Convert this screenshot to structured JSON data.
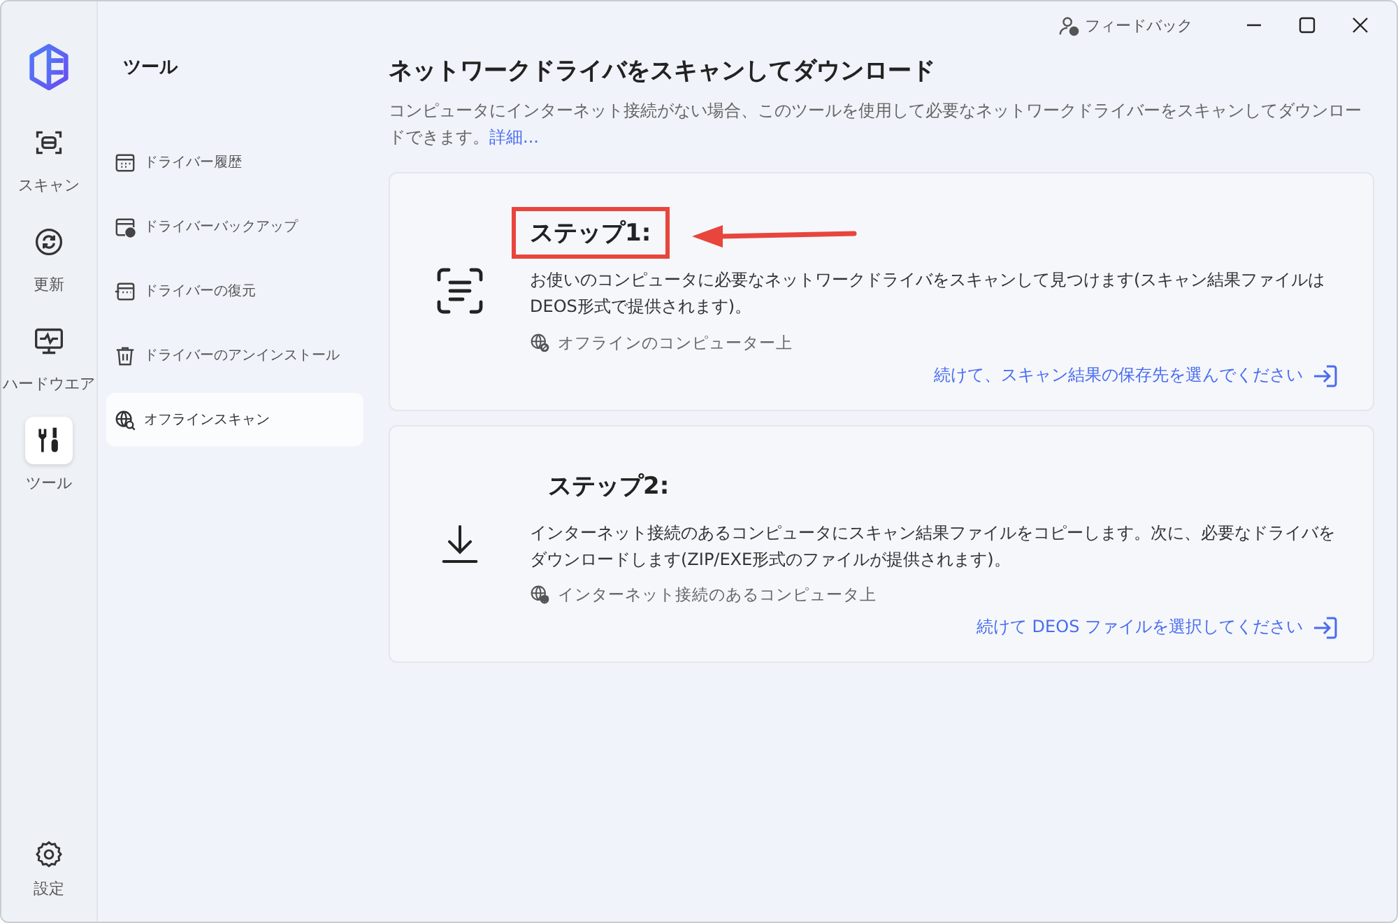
{
  "titlebar": {
    "feedback": "フィードバック"
  },
  "rail": {
    "items": [
      {
        "label": "スキャン",
        "selected": false
      },
      {
        "label": "更新",
        "selected": false
      },
      {
        "label": "ハードウエア",
        "selected": false
      },
      {
        "label": "ツール",
        "selected": true
      }
    ],
    "bottom": {
      "label": "設定"
    }
  },
  "tools_menu": {
    "title": "ツール",
    "items": [
      {
        "label": "ドライバー履歴",
        "selected": false
      },
      {
        "label": "ドライバーバックアップ",
        "selected": false
      },
      {
        "label": "ドライバーの復元",
        "selected": false
      },
      {
        "label": "ドライバーのアンインストール",
        "selected": false
      },
      {
        "label": "オフラインスキャン",
        "selected": true
      }
    ]
  },
  "main": {
    "title": "ネットワークドライバをスキャンしてダウンロード",
    "description": "コンピュータにインターネット接続がない場合、このツールを使用して必要なネットワークドライバーをスキャンしてダウンロードできます。",
    "more_link": "詳細...",
    "steps": [
      {
        "kind": "scan",
        "title": "ステップ1:",
        "highlighted": true,
        "text": "お使いのコンピュータに必要なネットワークドライバをスキャンして見つけます(スキャン結果ファイルはDEOS形式で提供されます)。",
        "location": "オフラインのコンピューター上",
        "action": "続けて、スキャン結果の保存先を選んでください"
      },
      {
        "kind": "download",
        "title": "ステップ2:",
        "highlighted": false,
        "text": "インターネット接続のあるコンピュータにスキャン結果ファイルをコピーします。次に、必要なドライバをダウンロードします(ZIP/EXE形式のファイルが提供されます)。",
        "location": "インターネット接続のあるコンピュータ上",
        "action": "続けて DEOS ファイルを選択してください"
      }
    ]
  }
}
